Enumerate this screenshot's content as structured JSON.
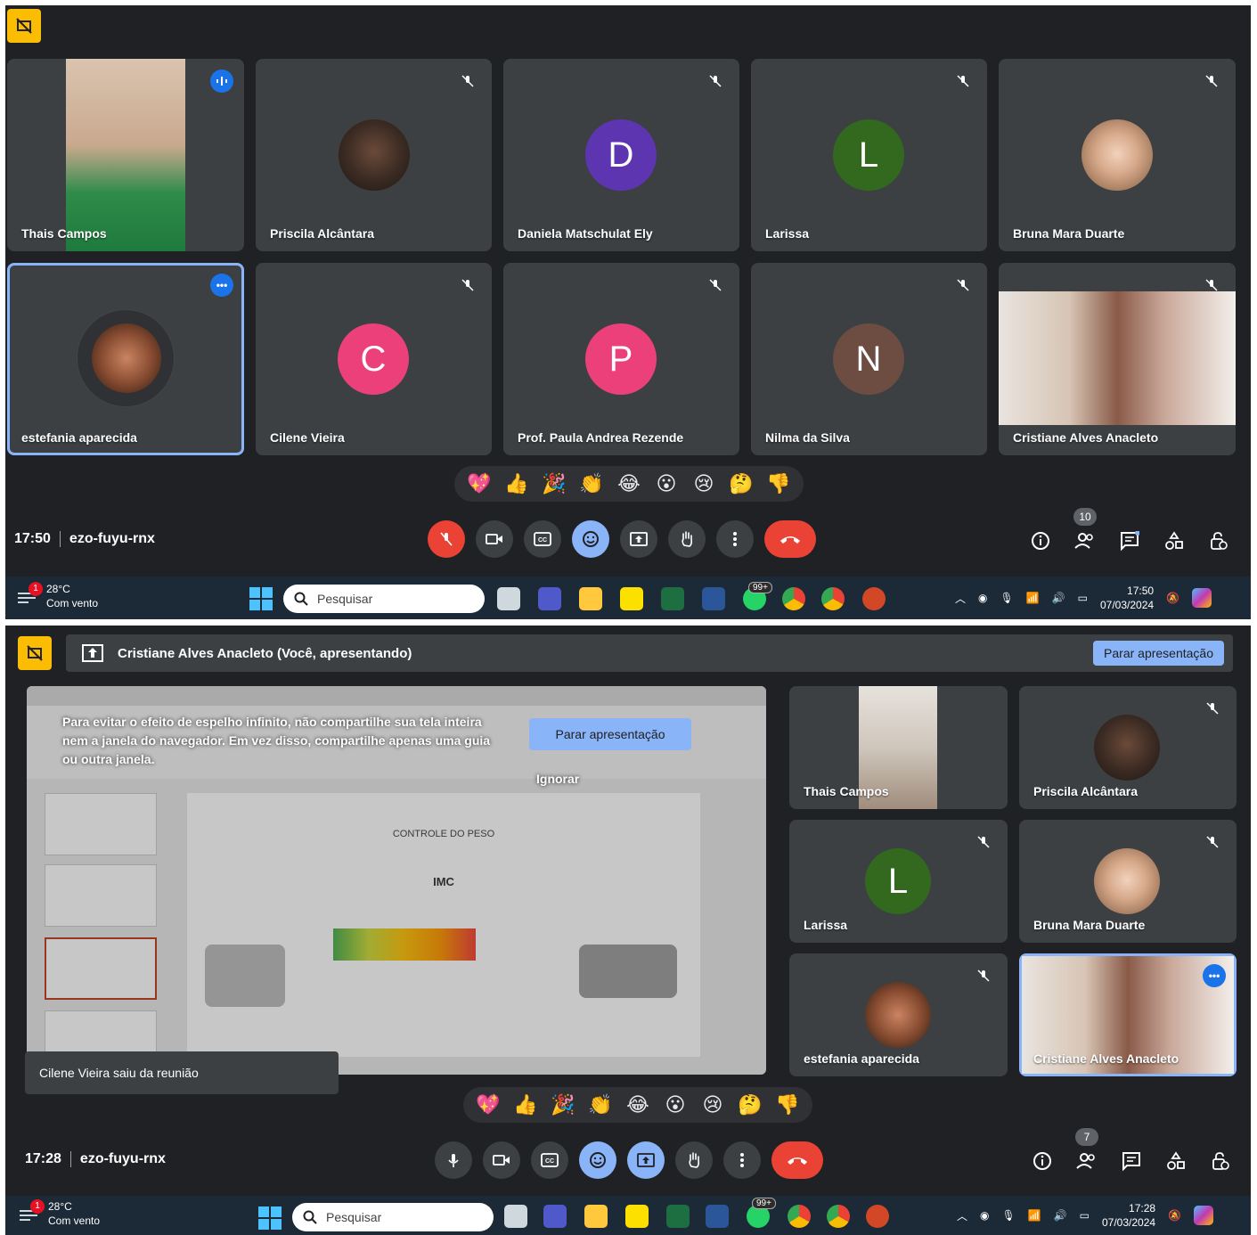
{
  "meeting1": {
    "time": "17:50",
    "code": "ezo-fuyu-rnx",
    "participant_count": "10",
    "tiles": [
      {
        "name": "Thais Campos",
        "type": "video"
      },
      {
        "name": "Priscila Alcântara",
        "type": "photo"
      },
      {
        "name": "Daniela Matschulat Ely",
        "type": "letter",
        "letter": "D",
        "color": "#5e35b1"
      },
      {
        "name": "Larissa",
        "type": "letter",
        "letter": "L",
        "color": "#33691e"
      },
      {
        "name": "Bruna Mara Duarte",
        "type": "photo"
      },
      {
        "name": "estefania aparecida",
        "type": "photo"
      },
      {
        "name": "Cilene Vieira",
        "type": "letter",
        "letter": "C",
        "color": "#ec407a"
      },
      {
        "name": "Prof. Paula Andrea Rezende",
        "type": "letter",
        "letter": "P",
        "color": "#ec407a"
      },
      {
        "name": "Nilma da Silva",
        "type": "letter",
        "letter": "N",
        "color": "#6d4c41"
      },
      {
        "name": "Cristiane Alves Anacleto",
        "type": "video"
      }
    ],
    "reactions": [
      "💖",
      "👍",
      "🎉",
      "👏",
      "😂",
      "😮",
      "😢",
      "🤔",
      "👎"
    ]
  },
  "taskbar1": {
    "temp": "28°C",
    "weather": "Com vento",
    "notif": "1",
    "search_placeholder": "Pesquisar",
    "whatsapp_badge": "99+",
    "clock_time": "17:50",
    "clock_date": "07/03/2024"
  },
  "meeting2": {
    "presenting_text": "Cristiane Alves Anacleto (Você, apresentando)",
    "stop_presenting": "Parar apresentação",
    "mirror_warning": "Para evitar o efeito de espelho infinito, não compartilhe sua tela inteira nem a janela do navegador. Em vez disso, compartilhe apenas uma guia ou outra janela.",
    "mirror_stop": "Parar apresentação",
    "mirror_ignore": "Ignorar",
    "slide_title": "CONTROLE DO PESO",
    "slide_imc": "IMC",
    "toast": "Cilene Vieira saiu da reunião",
    "time": "17:28",
    "code": "ezo-fuyu-rnx",
    "participant_count": "7",
    "tiles": [
      {
        "name": "Thais Campos"
      },
      {
        "name": "Priscila Alcântara"
      },
      {
        "name": "Larissa",
        "letter": "L",
        "color": "#33691e"
      },
      {
        "name": "Bruna Mara Duarte"
      },
      {
        "name": "estefania aparecida"
      },
      {
        "name": "Cristiane Alves Anacleto"
      }
    ],
    "reactions": [
      "💖",
      "👍",
      "🎉",
      "👏",
      "😂",
      "😮",
      "😢",
      "🤔",
      "👎"
    ]
  },
  "taskbar2": {
    "temp": "28°C",
    "weather": "Com vento",
    "notif": "1",
    "search_placeholder": "Pesquisar",
    "whatsapp_badge": "99+",
    "clock_time": "17:28",
    "clock_date": "07/03/2024"
  }
}
